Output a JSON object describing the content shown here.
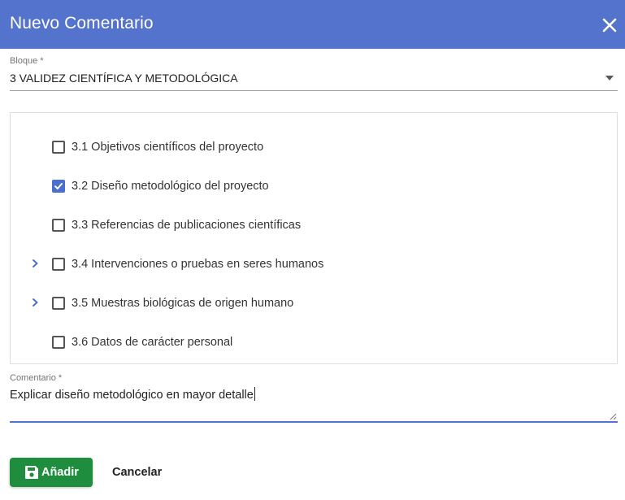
{
  "dialog": {
    "title": "Nuevo Comentario",
    "close_icon": "close-icon"
  },
  "block_field": {
    "label": "Bloque *",
    "value": "3 VALIDEZ CIENTÍFICA Y METODOLÓGICA",
    "icon": "dropdown-arrow-icon"
  },
  "tree": {
    "items": [
      {
        "label": "3.1 Objetivos científicos del proyecto",
        "checked": false,
        "expandable": false
      },
      {
        "label": "3.2 Diseño metodológico del proyecto",
        "checked": true,
        "expandable": false
      },
      {
        "label": "3.3 Referencias de publicaciones científicas",
        "checked": false,
        "expandable": false
      },
      {
        "label": "3.4 Intervenciones o pruebas en seres humanos",
        "checked": false,
        "expandable": true
      },
      {
        "label": "3.5 Muestras biológicas de origen humano",
        "checked": false,
        "expandable": true
      },
      {
        "label": "3.6 Datos de carácter personal",
        "checked": false,
        "expandable": false
      }
    ]
  },
  "comment_field": {
    "label": "Comentario *",
    "value": "Explicar diseño metodológico en mayor detalle"
  },
  "actions": {
    "add_label": "Añadir",
    "add_icon": "save-icon",
    "cancel_label": "Cancelar"
  },
  "colors": {
    "header": "#5473cc",
    "checkbox_checked": "#4a6fce",
    "add_button": "#1e8e3e",
    "focus_underline": "#5473cc"
  }
}
